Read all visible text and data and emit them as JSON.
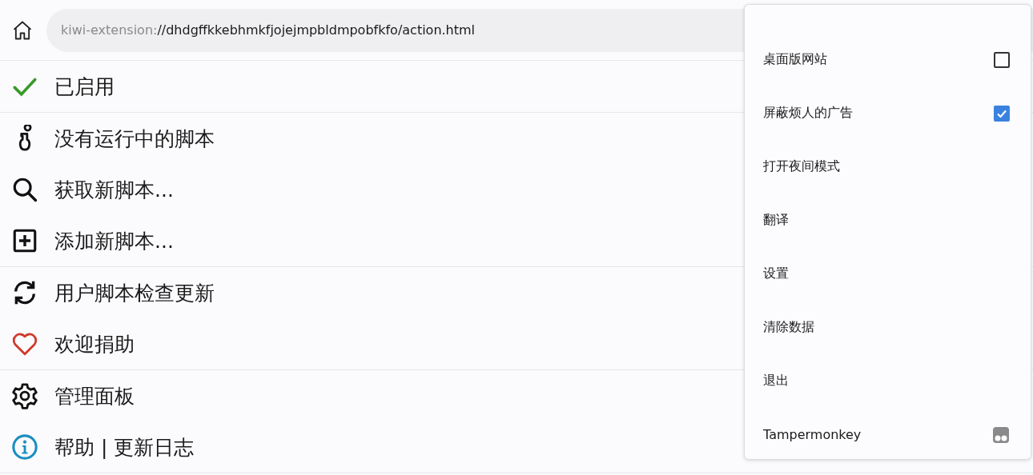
{
  "address_bar": {
    "scheme": "kiwi-extension:",
    "path": "//dhdgffkkebhmkfjojejmpbldmpobfkfo/action.html"
  },
  "menu_groups": [
    {
      "items": [
        {
          "kind": "check",
          "label": "已启用"
        }
      ]
    },
    {
      "items": [
        {
          "kind": "info",
          "label": "没有运行中的脚本"
        },
        {
          "kind": "search",
          "label": "获取新脚本..."
        },
        {
          "kind": "add",
          "label": "添加新脚本..."
        }
      ]
    },
    {
      "items": [
        {
          "kind": "refresh",
          "label": "用户脚本检查更新"
        },
        {
          "kind": "heart",
          "label": "欢迎捐助"
        }
      ]
    },
    {
      "items": [
        {
          "kind": "settings",
          "label": "管理面板"
        },
        {
          "kind": "help",
          "label": "帮助 | 更新日志"
        }
      ]
    }
  ],
  "overflow_menu": [
    {
      "kind": "checkbox",
      "label": "桌面版网站",
      "checked": false
    },
    {
      "kind": "checkbox",
      "label": "屏蔽烦人的广告",
      "checked": true
    },
    {
      "kind": "plain",
      "label": "打开夜间模式"
    },
    {
      "kind": "plain",
      "label": "翻译"
    },
    {
      "kind": "plain",
      "label": "设置"
    },
    {
      "kind": "plain",
      "label": "清除数据"
    },
    {
      "kind": "plain",
      "label": "退出"
    },
    {
      "kind": "extension",
      "label": "Tampermonkey"
    }
  ]
}
